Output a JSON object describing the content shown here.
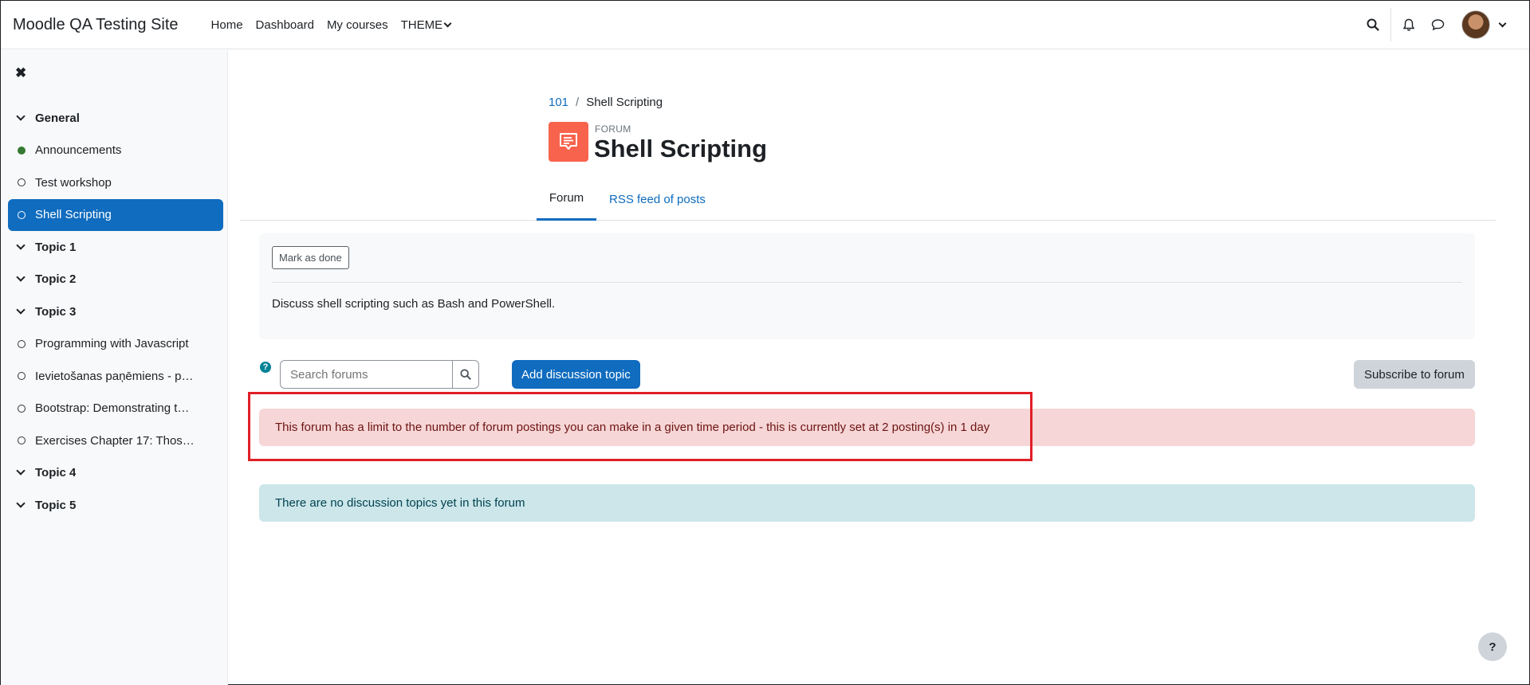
{
  "navbar": {
    "brand": "Moodle QA Testing Site",
    "links": [
      {
        "label": "Home"
      },
      {
        "label": "Dashboard"
      },
      {
        "label": "My courses"
      },
      {
        "label": "THEME"
      }
    ]
  },
  "sidebar": {
    "close_glyph": "✖",
    "items": [
      {
        "type": "section",
        "label": "General"
      },
      {
        "type": "activity",
        "label": "Announcements",
        "completed": true
      },
      {
        "type": "activity",
        "label": "Test workshop",
        "completed": false
      },
      {
        "type": "activity",
        "label": "Shell Scripting",
        "completed": false,
        "active": true
      },
      {
        "type": "section",
        "label": "Topic 1"
      },
      {
        "type": "section",
        "label": "Topic 2"
      },
      {
        "type": "section",
        "label": "Topic 3"
      },
      {
        "type": "activity",
        "label": "Programming with Javascript",
        "completed": false
      },
      {
        "type": "activity",
        "label": "Ievietošanas paņēmiens - p…",
        "completed": false
      },
      {
        "type": "activity",
        "label": "Bootstrap: Demonstrating th…",
        "completed": false
      },
      {
        "type": "activity",
        "label": "Exercises Chapter 17: Thos…",
        "completed": false
      },
      {
        "type": "section",
        "label": "Topic 4"
      },
      {
        "type": "section",
        "label": "Topic 5"
      }
    ]
  },
  "breadcrumb": {
    "course": "101",
    "separator": "/",
    "current": "Shell Scripting"
  },
  "activity": {
    "kind": "FORUM",
    "title": "Shell Scripting",
    "icon": "forum-icon",
    "icon_color": "#f7634d"
  },
  "tabs": [
    {
      "label": "Forum",
      "active": true
    },
    {
      "label": "RSS feed of posts",
      "active": false
    }
  ],
  "description": {
    "mark_done_label": "Mark as done",
    "text": "Discuss shell scripting such as Bash and PowerShell."
  },
  "toolbar": {
    "help_glyph": "?",
    "search_placeholder": "Search forums",
    "add_topic_label": "Add discussion topic",
    "subscribe_label": "Subscribe to forum"
  },
  "alerts": {
    "limit": "This forum has a limit to the number of forum postings you can make in a given time period - this is currently set at 2 posting(s) in 1 day",
    "empty": "There are no discussion topics yet in this forum"
  },
  "footer": {
    "help_glyph": "?"
  },
  "colors": {
    "primary": "#0f6cbf",
    "danger_bg": "#f6d6d6",
    "info_bg": "#cce6ea",
    "highlight_outline": "#e01f26"
  }
}
